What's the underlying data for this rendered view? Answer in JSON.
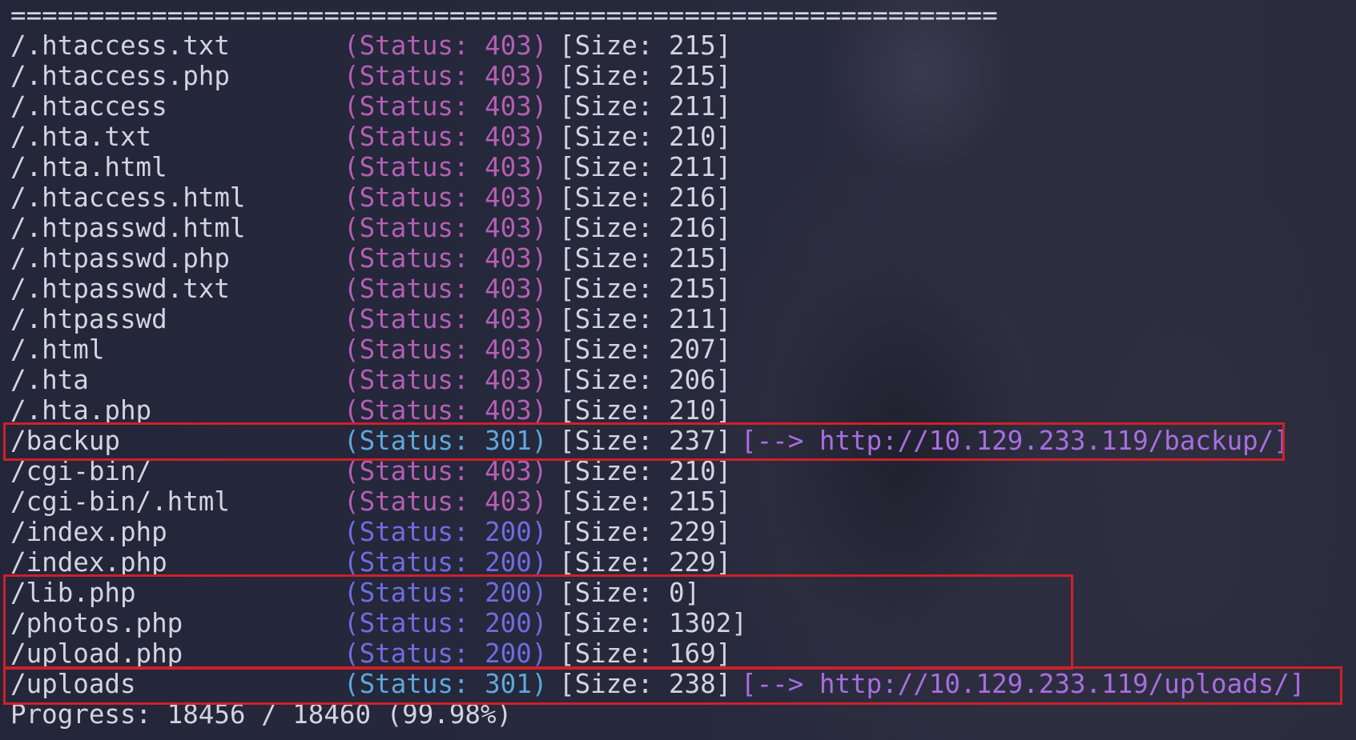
{
  "separator": "===============================================================",
  "rows": [
    {
      "path": "/.htaccess.txt",
      "status": "(Status: 403)",
      "code": "403",
      "size": "[Size: 215]",
      "redirect": ""
    },
    {
      "path": "/.htaccess.php",
      "status": "(Status: 403)",
      "code": "403",
      "size": "[Size: 215]",
      "redirect": ""
    },
    {
      "path": "/.htaccess",
      "status": "(Status: 403)",
      "code": "403",
      "size": "[Size: 211]",
      "redirect": ""
    },
    {
      "path": "/.hta.txt",
      "status": "(Status: 403)",
      "code": "403",
      "size": "[Size: 210]",
      "redirect": ""
    },
    {
      "path": "/.hta.html",
      "status": "(Status: 403)",
      "code": "403",
      "size": "[Size: 211]",
      "redirect": ""
    },
    {
      "path": "/.htaccess.html",
      "status": "(Status: 403)",
      "code": "403",
      "size": "[Size: 216]",
      "redirect": ""
    },
    {
      "path": "/.htpasswd.html",
      "status": "(Status: 403)",
      "code": "403",
      "size": "[Size: 216]",
      "redirect": ""
    },
    {
      "path": "/.htpasswd.php",
      "status": "(Status: 403)",
      "code": "403",
      "size": "[Size: 215]",
      "redirect": ""
    },
    {
      "path": "/.htpasswd.txt",
      "status": "(Status: 403)",
      "code": "403",
      "size": "[Size: 215]",
      "redirect": ""
    },
    {
      "path": "/.htpasswd",
      "status": "(Status: 403)",
      "code": "403",
      "size": "[Size: 211]",
      "redirect": ""
    },
    {
      "path": "/.html",
      "status": "(Status: 403)",
      "code": "403",
      "size": "[Size: 207]",
      "redirect": ""
    },
    {
      "path": "/.hta",
      "status": "(Status: 403)",
      "code": "403",
      "size": "[Size: 206]",
      "redirect": ""
    },
    {
      "path": "/.hta.php",
      "status": "(Status: 403)",
      "code": "403",
      "size": "[Size: 210]",
      "redirect": ""
    },
    {
      "path": "/backup",
      "status": "(Status: 301)",
      "code": "301",
      "size": "[Size: 237]",
      "redirect": "[--> http://10.129.233.119/backup/]"
    },
    {
      "path": "/cgi-bin/",
      "status": "(Status: 403)",
      "code": "403",
      "size": "[Size: 210]",
      "redirect": ""
    },
    {
      "path": "/cgi-bin/.html",
      "status": "(Status: 403)",
      "code": "403",
      "size": "[Size: 215]",
      "redirect": ""
    },
    {
      "path": "/index.php",
      "status": "(Status: 200)",
      "code": "200",
      "size": "[Size: 229]",
      "redirect": ""
    },
    {
      "path": "/index.php",
      "status": "(Status: 200)",
      "code": "200",
      "size": "[Size: 229]",
      "redirect": ""
    },
    {
      "path": "/lib.php",
      "status": "(Status: 200)",
      "code": "200",
      "size": "[Size: 0]",
      "redirect": ""
    },
    {
      "path": "/photos.php",
      "status": "(Status: 200)",
      "code": "200",
      "size": "[Size: 1302]",
      "redirect": ""
    },
    {
      "path": "/upload.php",
      "status": "(Status: 200)",
      "code": "200",
      "size": "[Size: 169]",
      "redirect": ""
    },
    {
      "path": "/uploads",
      "status": "(Status: 301)",
      "code": "301",
      "size": "[Size: 238]",
      "redirect": "[--> http://10.129.233.119/uploads/]"
    }
  ],
  "progress": "Progress: 18456 / 18460 (99.98%)",
  "colors": {
    "background": "#24263a",
    "text": "#d3d4de",
    "status_403": "#b45fb3",
    "status_200": "#6f6de0",
    "status_301": "#5ea8dc",
    "redirect": "#a96ee0",
    "highlight_box": "#d11f2a"
  }
}
